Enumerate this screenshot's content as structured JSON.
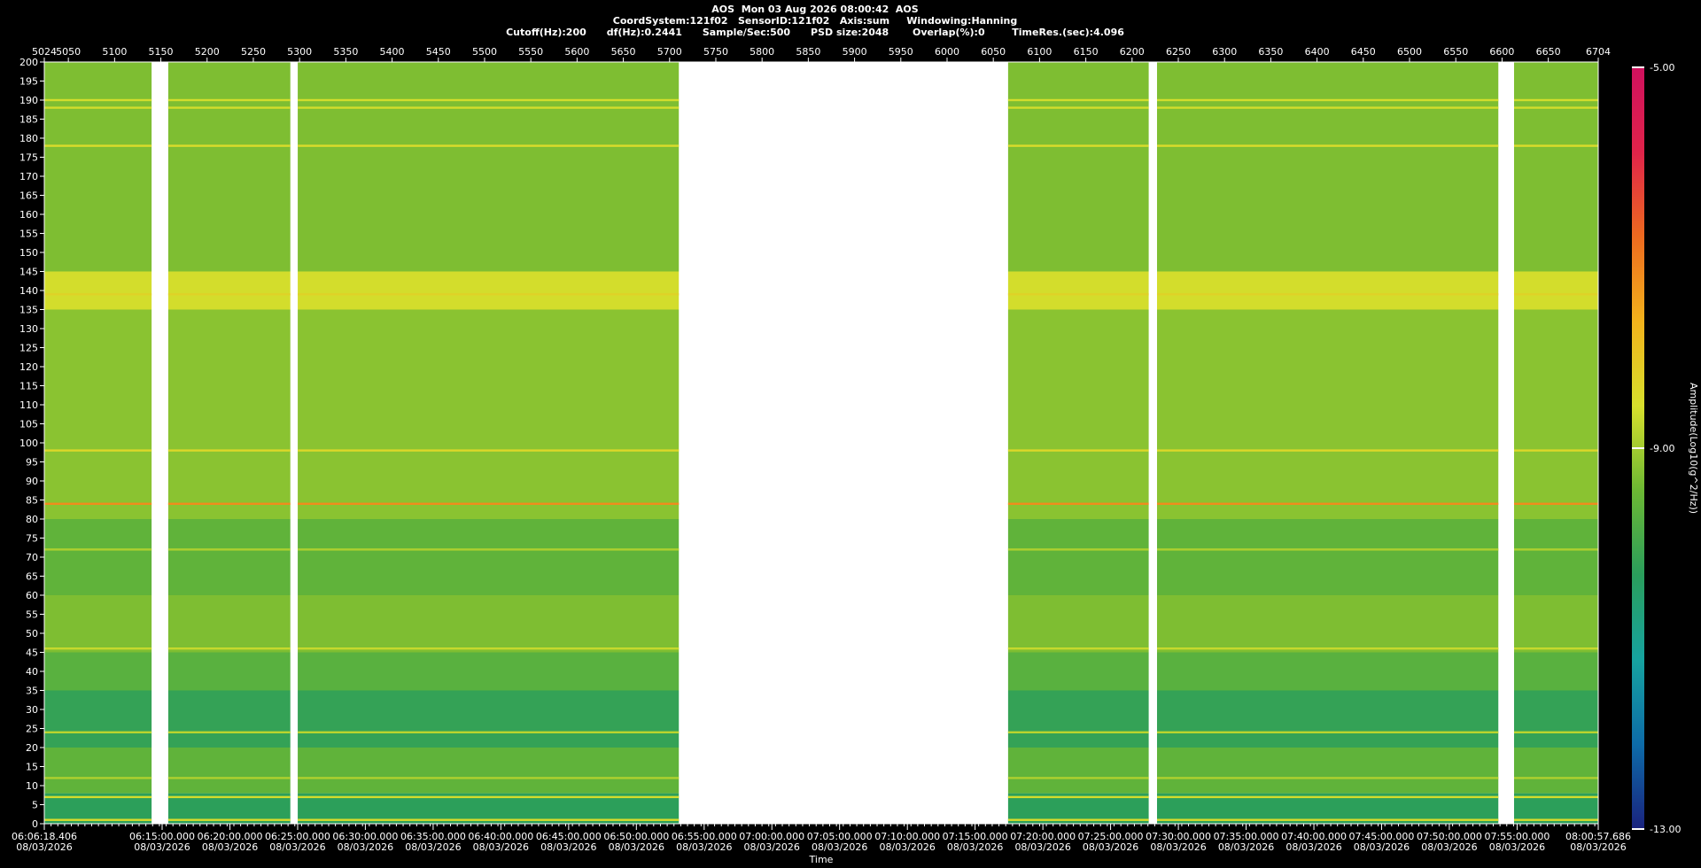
{
  "header": {
    "title_line": "AOS  Mon 03 Aug 2026 08:00:42  AOS",
    "info_line1": "CoordSystem:121f02   SensorID:121f02   Axis:sum     Windowing:Hanning",
    "info_line2": "Cutoff(Hz):200      df(Hz):0.2441      Sample/Sec:500      PSD size:2048       Overlap(%):0        TimeRes.(sec):4.096"
  },
  "chart_data": {
    "type": "heatmap",
    "title": "AOS  Mon 03 Aug 2026 08:00:42  AOS",
    "xlabel": "Time",
    "ylabel": "",
    "colorbar_label": "Amplitude(Log10(g^2/Hz))",
    "ylim": [
      0,
      200
    ],
    "y_ticks": [
      0,
      5,
      10,
      15,
      20,
      25,
      30,
      35,
      40,
      45,
      50,
      55,
      60,
      65,
      70,
      75,
      80,
      85,
      90,
      95,
      100,
      105,
      110,
      115,
      120,
      125,
      130,
      135,
      140,
      145,
      150,
      155,
      160,
      165,
      170,
      175,
      180,
      185,
      190,
      195,
      200
    ],
    "frame_range": [
      5024,
      6704
    ],
    "top_ticks": [
      5024,
      5050,
      5100,
      5150,
      5200,
      5250,
      5300,
      5350,
      5400,
      5450,
      5500,
      5550,
      5600,
      5650,
      5700,
      5750,
      5800,
      5850,
      5900,
      5950,
      6000,
      6050,
      6100,
      6150,
      6200,
      6250,
      6300,
      6350,
      6400,
      6450,
      6500,
      6550,
      6600,
      6650,
      6704
    ],
    "time_ticks": [
      {
        "time": "06:06:18.406",
        "date": "08/03/2026",
        "frame": 5024
      },
      {
        "time": "06:15:00.000",
        "date": "08/03/2026",
        "frame": 5151.4
      },
      {
        "time": "06:20:00.000",
        "date": "08/03/2026",
        "frame": 5224.7
      },
      {
        "time": "06:25:00.000",
        "date": "08/03/2026",
        "frame": 5297.9
      },
      {
        "time": "06:30:00.000",
        "date": "08/03/2026",
        "frame": 5371.1
      },
      {
        "time": "06:35:00.000",
        "date": "08/03/2026",
        "frame": 5444.4
      },
      {
        "time": "06:40:00.000",
        "date": "08/03/2026",
        "frame": 5517.6
      },
      {
        "time": "06:45:00.000",
        "date": "08/03/2026",
        "frame": 5590.9
      },
      {
        "time": "06:50:00.000",
        "date": "08/03/2026",
        "frame": 5664.1
      },
      {
        "time": "06:55:00.000",
        "date": "08/03/2026",
        "frame": 5737.4
      },
      {
        "time": "07:00:00.000",
        "date": "08/03/2026",
        "frame": 5810.6
      },
      {
        "time": "07:05:00.000",
        "date": "08/03/2026",
        "frame": 5883.8
      },
      {
        "time": "07:10:00.000",
        "date": "08/03/2026",
        "frame": 5957.1
      },
      {
        "time": "07:15:00.000",
        "date": "08/03/2026",
        "frame": 6030.3
      },
      {
        "time": "07:20:00.000",
        "date": "08/03/2026",
        "frame": 6103.6
      },
      {
        "time": "07:25:00.000",
        "date": "08/03/2026",
        "frame": 6176.8
      },
      {
        "time": "07:30:00.000",
        "date": "08/03/2026",
        "frame": 6250.1
      },
      {
        "time": "07:35:00.000",
        "date": "08/03/2026",
        "frame": 6323.3
      },
      {
        "time": "07:40:00.000",
        "date": "08/03/2026",
        "frame": 6396.6
      },
      {
        "time": "07:45:00.000",
        "date": "08/03/2026",
        "frame": 6469.8
      },
      {
        "time": "07:50:00.000",
        "date": "08/03/2026",
        "frame": 6543.0
      },
      {
        "time": "07:55:00.000",
        "date": "08/03/2026",
        "frame": 6616.3
      },
      {
        "time": "08:00:57.686",
        "date": "08/03/2026",
        "frame": 6704
      }
    ],
    "data_segments": [
      {
        "frame_start": 5024,
        "frame_end": 5140
      },
      {
        "frame_start": 5158,
        "frame_end": 5290
      },
      {
        "frame_start": 5298,
        "frame_end": 5710
      },
      {
        "frame_start": 6066,
        "frame_end": 6218
      },
      {
        "frame_start": 6227,
        "frame_end": 6596
      },
      {
        "frame_start": 6613,
        "frame_end": 6704
      }
    ],
    "background_level_by_band": [
      {
        "f_min": 0,
        "f_max": 8,
        "level": -10.3
      },
      {
        "f_min": 8,
        "f_max": 20,
        "level": -9.6
      },
      {
        "f_min": 20,
        "f_max": 35,
        "level": -10.2
      },
      {
        "f_min": 35,
        "f_max": 45,
        "level": -9.7
      },
      {
        "f_min": 45,
        "f_max": 60,
        "level": -9.3
      },
      {
        "f_min": 60,
        "f_max": 80,
        "level": -9.6
      },
      {
        "f_min": 80,
        "f_max": 135,
        "level": -9.2
      },
      {
        "f_min": 135,
        "f_max": 145,
        "level": -8.6
      },
      {
        "f_min": 145,
        "f_max": 200,
        "level": -9.3
      }
    ],
    "tonal_lines_hz": [
      {
        "freq": 1,
        "level": -8.5
      },
      {
        "freq": 7,
        "level": -8.6
      },
      {
        "freq": 12,
        "level": -8.9
      },
      {
        "freq": 24,
        "level": -8.8
      },
      {
        "freq": 46,
        "level": -8.7
      },
      {
        "freq": 72,
        "level": -8.9
      },
      {
        "freq": 84,
        "level": -7.2
      },
      {
        "freq": 98,
        "level": -8.4
      },
      {
        "freq": 139,
        "level": -8.3
      },
      {
        "freq": 178,
        "level": -8.5
      },
      {
        "freq": 188,
        "level": -8.6
      },
      {
        "freq": 190,
        "level": -8.6
      }
    ],
    "colorbar": {
      "min": -13.0,
      "max": -5.0,
      "tick_labels": [
        "-5.00",
        "-9.00",
        "-13.00"
      ],
      "tick_values": [
        -5.0,
        -9.0,
        -13.0
      ],
      "stops": [
        "#1a237e",
        "#0d6ba8",
        "#16a3a0",
        "#2a9e5c",
        "#6cb833",
        "#d8df2c",
        "#f2b21b",
        "#ee6a1f",
        "#e0234a",
        "#d0115e"
      ]
    },
    "background_color": "#000000",
    "gap_color": "#ffffff"
  }
}
